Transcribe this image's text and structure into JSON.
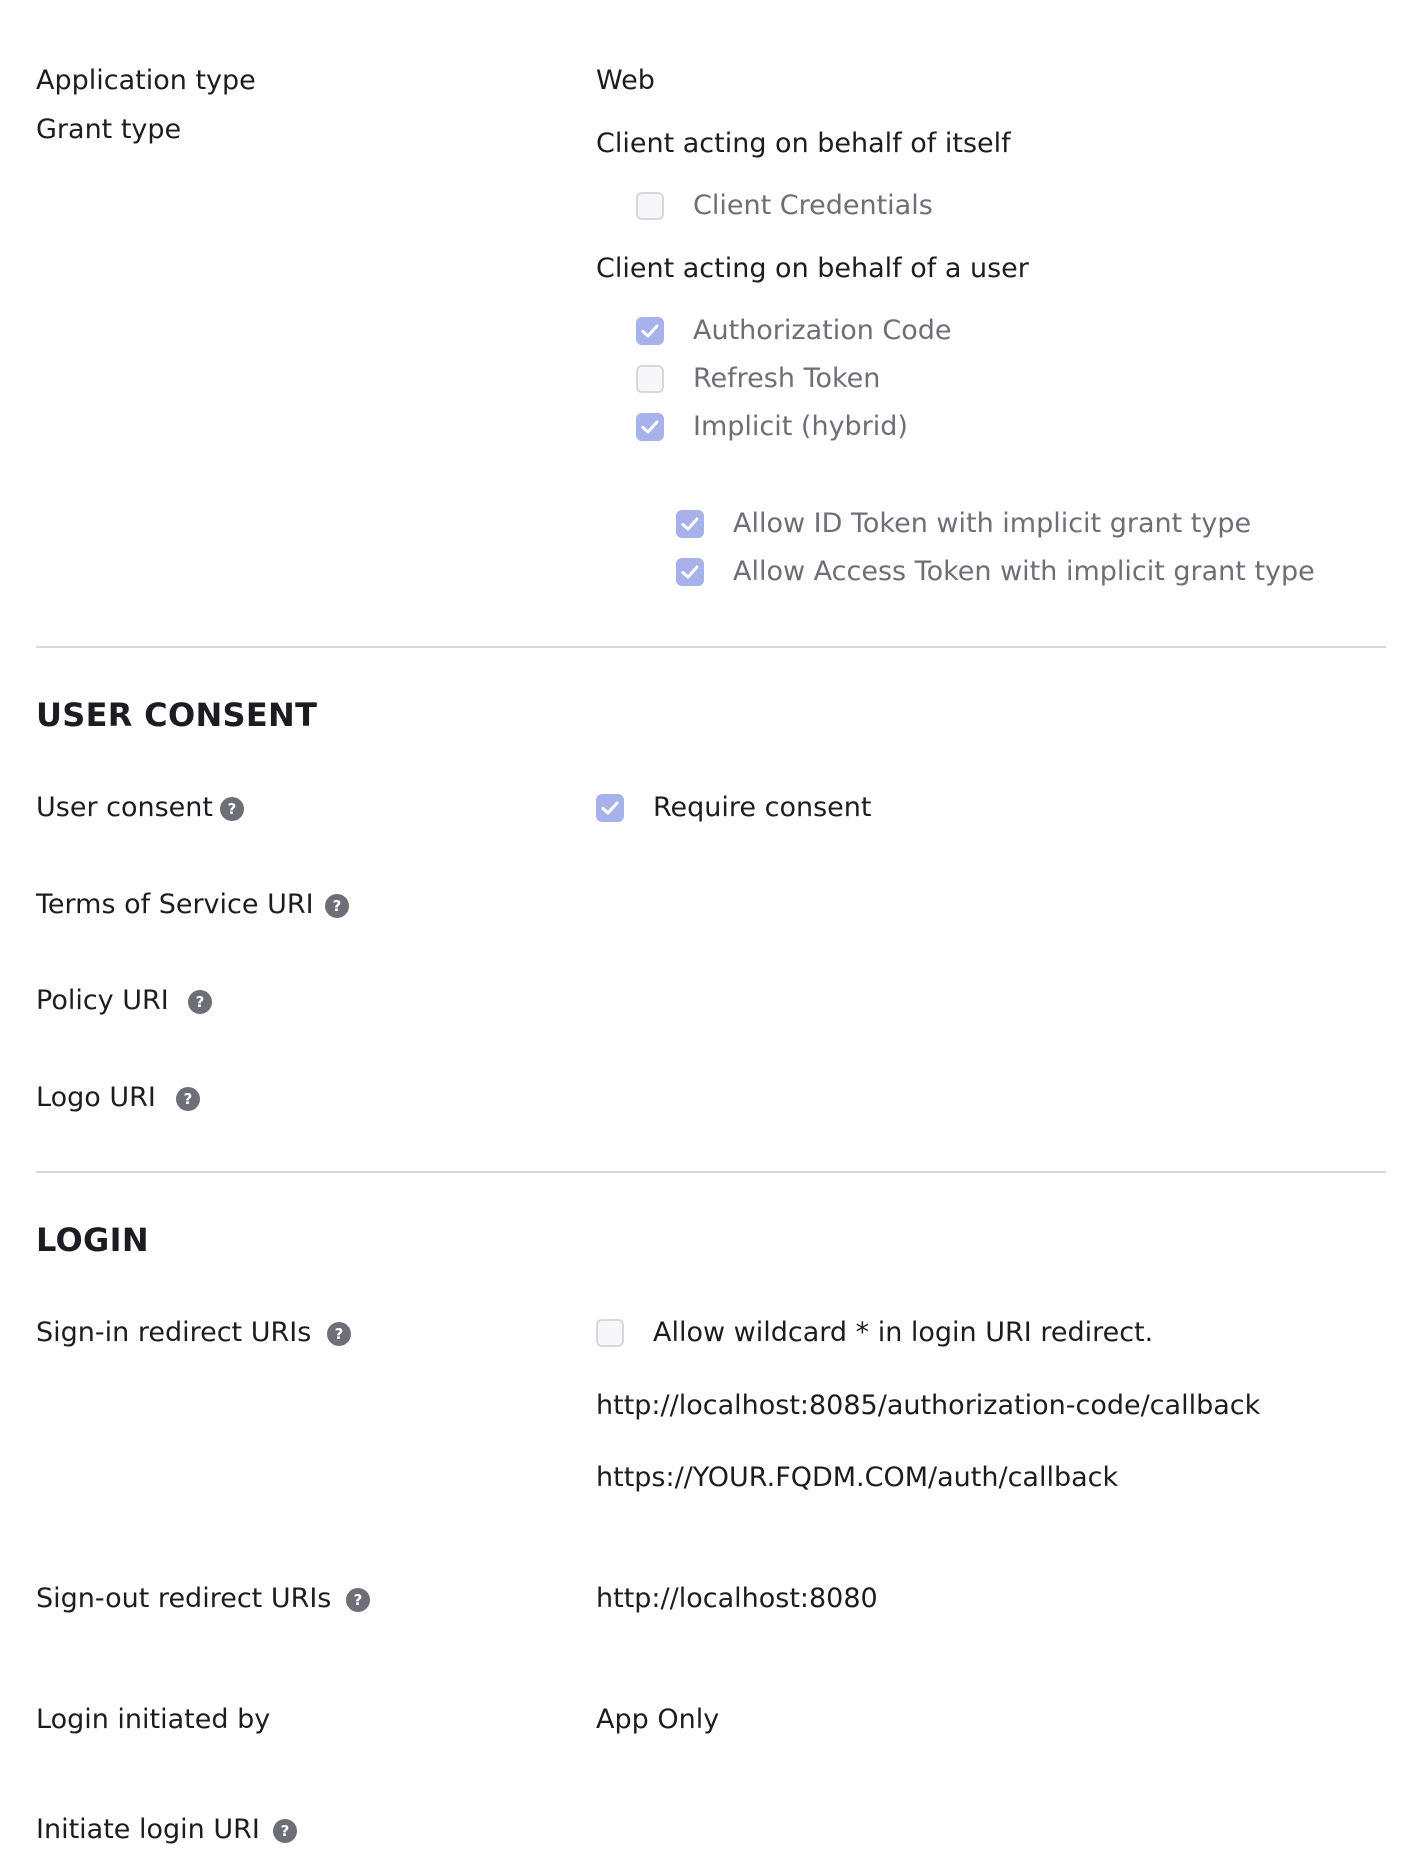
{
  "general": {
    "application_type_label": "Application type",
    "application_type_value": "Web",
    "grant_type_label": "Grant type",
    "client_self_heading": "Client acting on behalf of itself",
    "client_credentials": "Client Credentials",
    "client_user_heading": "Client acting on behalf of a user",
    "authorization_code": "Authorization Code",
    "refresh_token": "Refresh Token",
    "implicit_hybrid": "Implicit (hybrid)",
    "allow_id_token": "Allow ID Token with implicit grant type",
    "allow_access_token": "Allow Access Token with implicit grant type"
  },
  "user_consent": {
    "heading": "USER CONSENT",
    "user_consent_label": "User consent",
    "require_consent": "Require consent",
    "terms_label": "Terms of Service URI",
    "policy_label": "Policy URI",
    "logo_label": "Logo URI"
  },
  "login": {
    "heading": "LOGIN",
    "sign_in_label": "Sign-in redirect URIs",
    "allow_wildcard": "Allow wildcard * in login URI redirect.",
    "sign_in_uris": [
      "http://localhost:8085/authorization-code/callback",
      "https://YOUR.FQDM.COM/auth/callback"
    ],
    "sign_out_label": "Sign-out redirect URIs",
    "sign_out_uri": "http://localhost:8080",
    "login_initiated_label": "Login initiated by",
    "login_initiated_value": "App Only",
    "initiate_login_label": "Initiate login URI"
  },
  "icons": {
    "help": "?",
    "check": "check-icon"
  },
  "colors": {
    "checkbox_checked": "#a7b1ea",
    "divider": "#d7d7dc",
    "help_icon": "#6e6e78"
  }
}
